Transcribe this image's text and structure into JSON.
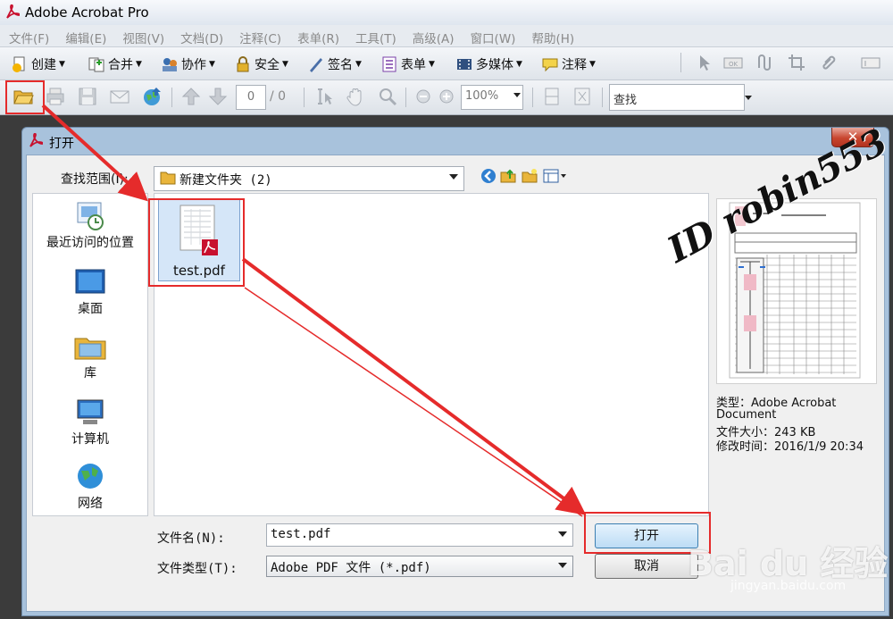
{
  "app": {
    "title": "Adobe Acrobat Pro"
  },
  "menu": [
    "文件(F)",
    "编辑(E)",
    "视图(V)",
    "文档(D)",
    "注释(C)",
    "表单(R)",
    "工具(T)",
    "高级(A)",
    "窗口(W)",
    "帮助(H)"
  ],
  "toolbar1": {
    "create": "创建",
    "combine": "合并",
    "collaborate": "协作",
    "security": "安全",
    "sign": "签名",
    "forms": "表单",
    "multimedia": "多媒体",
    "comment": "注释"
  },
  "toolbar2": {
    "page_value": "0",
    "page_total": "/ 0",
    "zoom": "100%",
    "search_placeholder": "查找"
  },
  "dialog": {
    "title": "打开",
    "close": "✕",
    "look_in_label": "查找范围(I):",
    "look_in_value": "新建文件夹 (2)",
    "places": [
      "最近访问的位置",
      "桌面",
      "库",
      "计算机",
      "网络"
    ],
    "file_name": "test.pdf",
    "preview": {
      "type_line1": "类型：Adobe Acrobat",
      "type_line2": "Document",
      "size": "文件大小：243 KB",
      "modified": "修改时间：2016/1/9 20:34"
    },
    "filename_label": "文件名(N):",
    "filename_value": "test.pdf",
    "filetype_label": "文件类型(T):",
    "filetype_value": "Adobe PDF 文件 (*.pdf)",
    "open_button": "打开",
    "cancel_button": "取消"
  },
  "watermarks": {
    "id": "ID robin553",
    "baidu": "Bai du 经验",
    "baidu_url": "jingyan.baidu.com"
  },
  "colors": {
    "highlight": "#e52b2b",
    "dialog_frame": "#a8c2dc",
    "open_button": "#bcdcf5"
  }
}
